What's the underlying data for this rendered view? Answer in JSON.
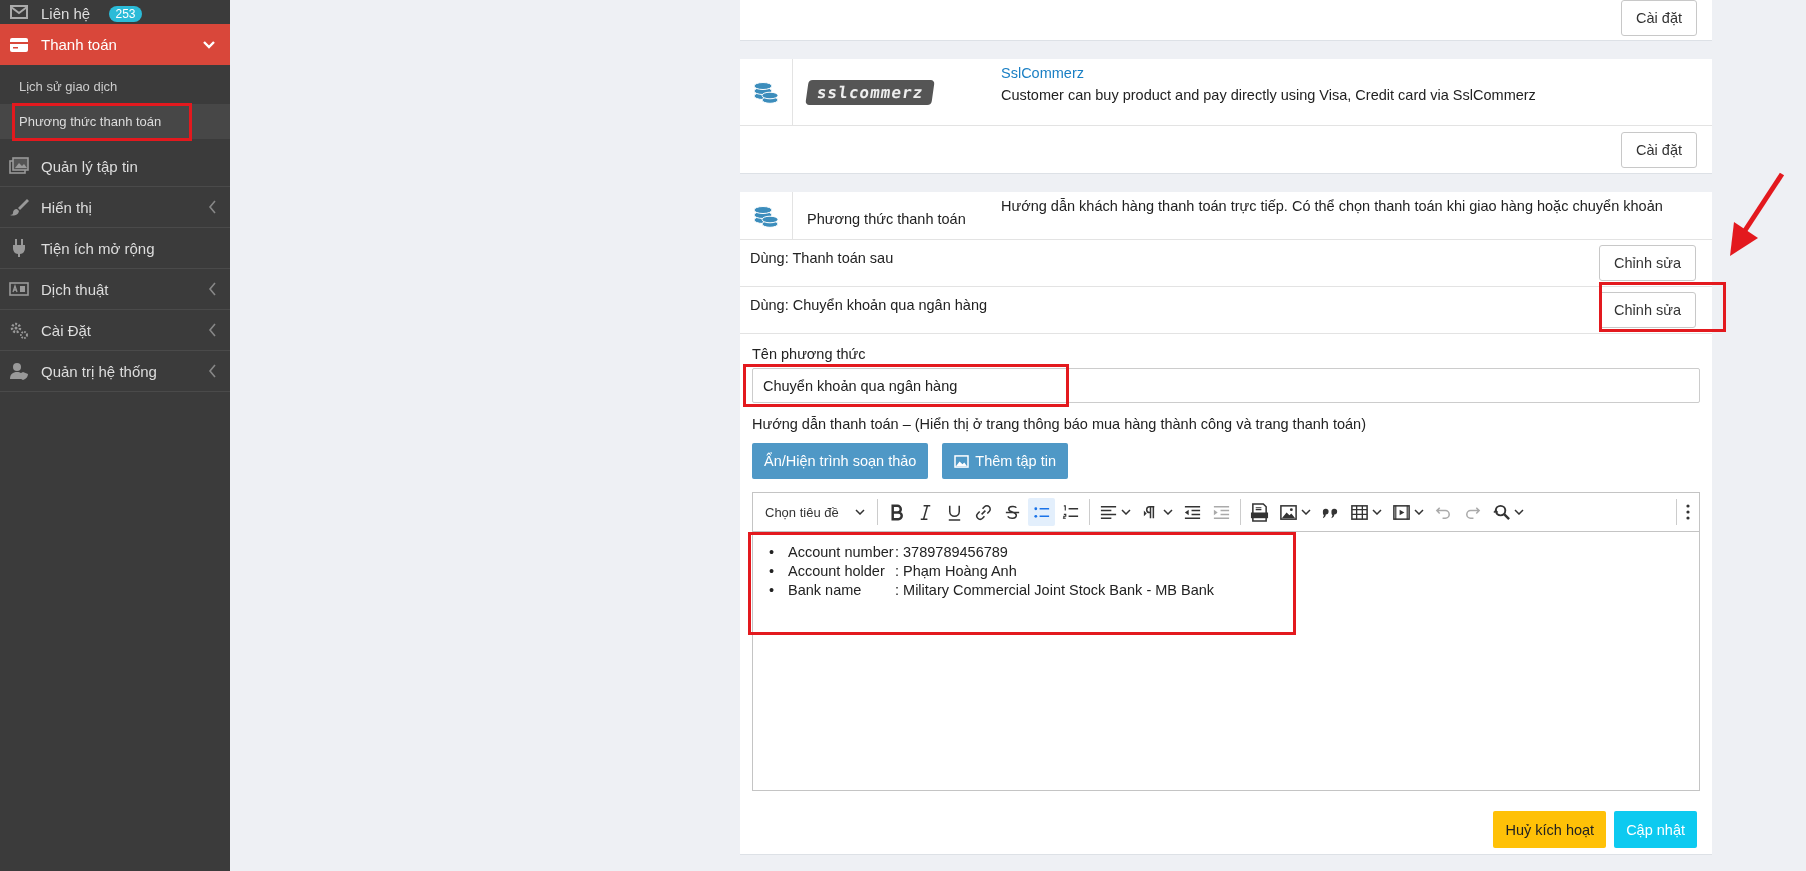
{
  "sidebar": {
    "items": [
      {
        "kind": "link",
        "label": "Liên hệ",
        "badge": "253"
      },
      {
        "kind": "group",
        "label": "Thanh toán",
        "expanded": true,
        "children": [
          {
            "label": "Lịch sử giao dịch",
            "selected": false
          },
          {
            "label": "Phương thức thanh toán",
            "selected": true
          }
        ]
      },
      {
        "kind": "link",
        "label": "Quản lý tập tin"
      },
      {
        "kind": "group",
        "label": "Hiển thị",
        "expanded": false
      },
      {
        "kind": "link",
        "label": "Tiện ích mở rộng"
      },
      {
        "kind": "group",
        "label": "Dịch thuật",
        "expanded": false
      },
      {
        "kind": "group",
        "label": "Cài Đặt",
        "expanded": false
      },
      {
        "kind": "group",
        "label": "Quản trị hệ thống",
        "expanded": false
      }
    ]
  },
  "payment_methods": [
    {
      "kind": "footer_only",
      "button": "Cài đặt"
    },
    {
      "kind": "plugin",
      "logo": "sslcommerz",
      "name": "SslCommerz",
      "description": "Customer can buy product and pay directly using Visa, Credit card via SslCommerz",
      "button": "Cài đặt"
    },
    {
      "kind": "builtin",
      "name": "Phương thức thanh toán",
      "description": "Hướng dẫn khách hàng thanh toán trực tiếp. Có thể chọn thanh toán khi giao hàng hoặc chuyển khoản",
      "options": [
        {
          "label": "Dùng: Thanh toán sau",
          "button": "Chỉnh sửa"
        },
        {
          "label": "Dùng: Chuyển khoản qua ngân hàng",
          "button": "Chỉnh sửa"
        }
      ],
      "form": {
        "name_label": "Tên phương thức",
        "name_value": "Chuyển khoản qua ngân hàng",
        "instructions_label": "Hướng dẫn thanh toán – (Hiển thị ở trang thông báo mua hàng thành công và trang thanh toán)",
        "buttons": [
          {
            "kind": "toggle",
            "label": "Ẩn/Hiện trình soạn thảo"
          },
          {
            "kind": "attach",
            "label": "Thêm tập tin"
          }
        ],
        "editor": {
          "heading_select": "Chọn tiêu đề",
          "toolbar": [
            [
              {
                "kind": "bold",
                "selected": false,
                "disabled": false,
                "dropdown": false
              },
              {
                "kind": "italic",
                "selected": false,
                "disabled": false,
                "dropdown": false
              },
              {
                "kind": "underline",
                "selected": false,
                "disabled": false,
                "dropdown": false
              },
              {
                "kind": "link",
                "selected": false,
                "disabled": false,
                "dropdown": false
              },
              {
                "kind": "strikethrough",
                "selected": false,
                "disabled": false,
                "dropdown": false
              },
              {
                "kind": "bulleted_list",
                "selected": true,
                "disabled": false,
                "dropdown": false
              },
              {
                "kind": "numbered_list",
                "selected": false,
                "disabled": false,
                "dropdown": false
              }
            ],
            [
              {
                "kind": "align",
                "selected": false,
                "disabled": false,
                "dropdown": true
              },
              {
                "kind": "paragraph",
                "selected": false,
                "disabled": false,
                "dropdown": true
              },
              {
                "kind": "outdent",
                "selected": false,
                "disabled": false,
                "dropdown": false
              },
              {
                "kind": "indent",
                "selected": false,
                "disabled": true,
                "dropdown": false
              }
            ],
            [
              {
                "kind": "html",
                "selected": false,
                "disabled": false,
                "dropdown": false
              },
              {
                "kind": "image",
                "selected": false,
                "disabled": false,
                "dropdown": true
              },
              {
                "kind": "quote",
                "selected": false,
                "disabled": false,
                "dropdown": false
              },
              {
                "kind": "table",
                "selected": false,
                "disabled": false,
                "dropdown": true
              },
              {
                "kind": "media",
                "selected": false,
                "disabled": false,
                "dropdown": true
              },
              {
                "kind": "undo",
                "selected": false,
                "disabled": true,
                "dropdown": false
              },
              {
                "kind": "redo",
                "selected": false,
                "disabled": true,
                "dropdown": false
              },
              {
                "kind": "find",
                "selected": false,
                "disabled": false,
                "dropdown": true
              }
            ],
            [
              {
                "kind": "more",
                "selected": false,
                "disabled": false,
                "dropdown": false
              }
            ]
          ],
          "content": [
            {
              "bullet": "•",
              "label": "Account number",
              "value": ": 3789789456789"
            },
            {
              "bullet": "•",
              "label": "Account holder",
              "value": ": Phạm Hoàng Anh"
            },
            {
              "bullet": "•",
              "label": "Bank name",
              "value": ": Military Commercial Joint Stock Bank - MB Bank"
            }
          ]
        },
        "actions": [
          {
            "kind": "warning",
            "label": "Huỷ kích hoạt"
          },
          {
            "kind": "info",
            "label": "Cập nhật"
          }
        ]
      }
    }
  ]
}
